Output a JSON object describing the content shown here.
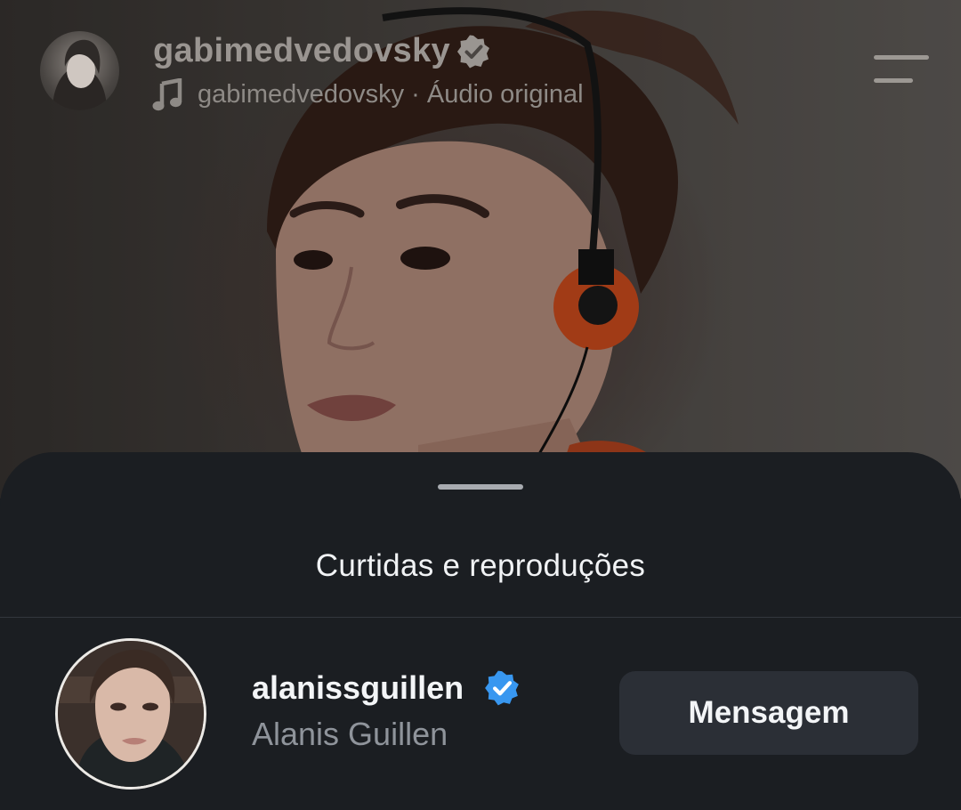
{
  "header": {
    "username": "gabimedvedovsky",
    "audio_line": "gabimedvedovsky · Áudio original"
  },
  "sheet": {
    "title": "Curtidas e reproduções"
  },
  "users": [
    {
      "username": "alanissguillen",
      "full_name": "Alanis Guillen",
      "action_label": "Mensagem",
      "verified": true
    }
  ],
  "icons": {
    "owner_verified": "verified-badge-icon",
    "music": "music-note-icon",
    "menu": "menu-icon",
    "user_verified": "verified-badge-icon"
  },
  "colors": {
    "sheet_background": "#1b1e22",
    "button_background": "#2b2f36",
    "verified_blue": "#3897f0",
    "headphone_orange": "#e0531f"
  }
}
